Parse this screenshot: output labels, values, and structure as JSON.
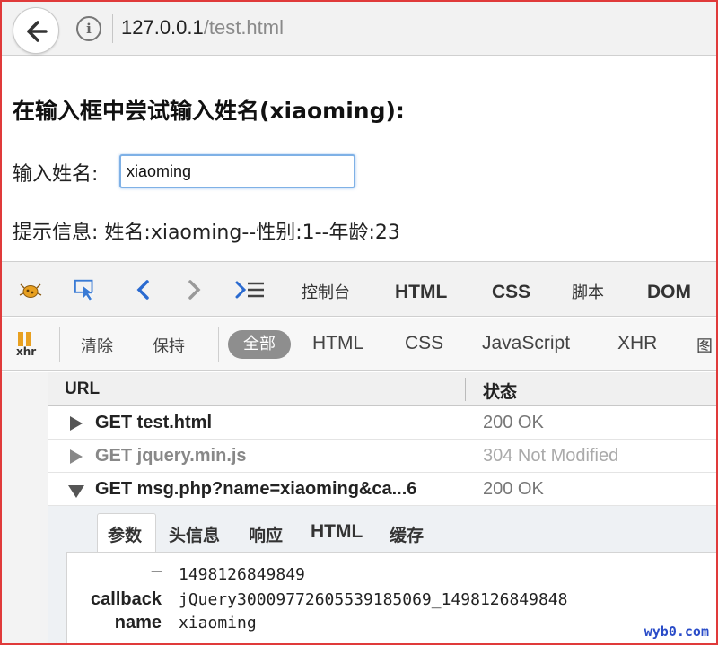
{
  "browser": {
    "url_host": "127.0.0.1",
    "url_path": "/test.html"
  },
  "page": {
    "title": "在输入框中尝试输入姓名(xiaoming):",
    "input_label": "输入姓名:",
    "input_value": "xiaoming",
    "hint_text": "提示信息: 姓名:xiaoming--性别:1--年龄:23"
  },
  "devtools": {
    "tabs": [
      "控制台",
      "HTML",
      "CSS",
      "脚本",
      "DOM"
    ]
  },
  "net_filters": {
    "xhr_icon_label": "xhr",
    "clear": "清除",
    "persist": "保持",
    "all": "全部",
    "html": "HTML",
    "css": "CSS",
    "javascript": "JavaScript",
    "xhr": "XHR",
    "images": "图"
  },
  "request_list": {
    "col_url": "URL",
    "col_status": "状态",
    "rows": [
      {
        "request": "GET test.html",
        "status": "200 OK"
      },
      {
        "request": "GET jquery.min.js",
        "status": "304 Not Modified"
      },
      {
        "request": "GET msg.php?name=xiaoming&ca...6",
        "status": "200 OK"
      }
    ]
  },
  "detail": {
    "tabs": [
      "参数",
      "头信息",
      "响应",
      "HTML",
      "缓存"
    ],
    "params": [
      {
        "key": "_",
        "value": "1498126849849"
      },
      {
        "key": "callback",
        "value": "jQuery30009772605539185069_1498126849848"
      },
      {
        "key": "name",
        "value": "xiaoming"
      }
    ]
  },
  "watermark": "wyb0.com"
}
